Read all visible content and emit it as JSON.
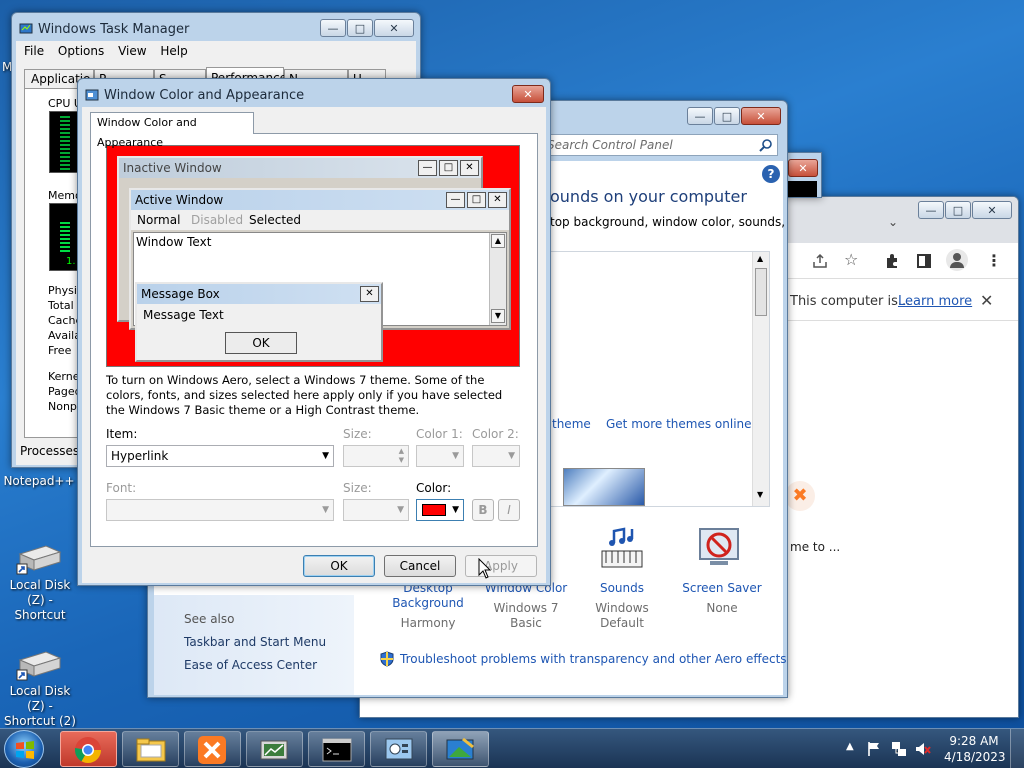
{
  "desktop": {
    "icons": [
      {
        "label": "Notepad++"
      },
      {
        "label": "Local Disk (Z) - Shortcut"
      },
      {
        "label": "Local Disk (Z) - Shortcut (2)"
      }
    ],
    "partial_edge_letter": "M"
  },
  "task_manager": {
    "title": "Windows Task Manager",
    "menu": [
      "File",
      "Options",
      "View",
      "Help"
    ],
    "tabs": [
      "Applicatio",
      "P",
      "S",
      "Performance",
      "N",
      "U"
    ],
    "cpu_label": "CPU U",
    "memory_label": "Memo",
    "physical_rows": [
      "Physic",
      "Total",
      "Cache",
      "Availa",
      "Free"
    ],
    "kernel_rows": [
      "Kerne",
      "Paged",
      "Nonpa"
    ],
    "processes_label": "Processes:",
    "mem_readout": "1."
  },
  "control_panel": {
    "search_placeholder": "Search Control Panel",
    "heading": "ounds on your computer",
    "subheading": "top background, window color, sounds,",
    "link_theme": "theme",
    "link_more_themes": "Get more themes online",
    "bottom_items": [
      {
        "label": "Desktop Background",
        "value": "Harmony"
      },
      {
        "label": "Window Color",
        "value": "Windows 7 Basic"
      },
      {
        "label": "Sounds",
        "value": "Windows Default"
      },
      {
        "label": "Screen Saver",
        "value": "None"
      }
    ],
    "see_also": "See also",
    "see_also_items": [
      "Taskbar and Start Menu",
      "Ease of Access Center"
    ],
    "troubleshoot_link": "Troubleshoot problems with transparency and other Aero effects"
  },
  "chrome": {
    "info_bar_text": "This computer is...",
    "learn_more": "Learn more",
    "page_text": "me to ..."
  },
  "dialog": {
    "title": "Window Color and Appearance",
    "tab_label": "Window Color and Appearance",
    "preview": {
      "inactive_window": "Inactive Window",
      "active_window": "Active Window",
      "menu_normal": "Normal",
      "menu_disabled": "Disabled",
      "menu_selected": "Selected",
      "window_text": "Window Text",
      "message_box": "Message Box",
      "message_text": "Message Text",
      "ok": "OK"
    },
    "description": "To turn on Windows Aero, select a Windows 7 theme.  Some of the colors, fonts, and sizes selected here apply only if you have selected the Windows 7 Basic theme or a High Contrast theme.",
    "labels": {
      "item": "Item:",
      "size": "Size:",
      "color1": "Color 1:",
      "color2": "Color 2:",
      "font": "Font:",
      "size2": "Size:",
      "color": "Color:"
    },
    "item_value": "Hyperlink",
    "selected_color": "#ff0000",
    "bold_label": "B",
    "italic_label": "I",
    "buttons": {
      "ok": "OK",
      "cancel": "Cancel",
      "apply": "Apply"
    }
  },
  "taskbar": {
    "time": "9:28 AM",
    "date": "4/18/2023",
    "pinned": [
      "chrome-icon",
      "explorer-icon",
      "xampp-icon",
      "network-icon",
      "cmd-icon",
      "control-panel-icon",
      "personalize-icon"
    ]
  }
}
